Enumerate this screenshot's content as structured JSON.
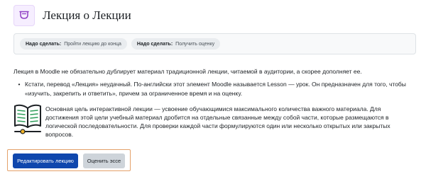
{
  "header": {
    "title": "Лекция о Лекции",
    "icon": "lesson-icon",
    "icon_color": "#8f3fc4"
  },
  "completion": {
    "items": [
      {
        "label": "Надо сделать:",
        "requirement": "Пройти лекцию до конца"
      },
      {
        "label": "Надо сделать:",
        "requirement": "Получить оценку"
      }
    ]
  },
  "content": {
    "intro": "Лекция в Moodle не обязательно дублирует материал традиционной лекции, читаемой в аудитории, а скорее дополняет ее.",
    "bullet": "Кстати, перевод «Лекция» неудачный. По-английски этот элемент Moodle называется Lesson — урок. Он предназначен для того, чтобы «изучить, закрепить и ответить», причем за ограниченное время и на оценку.",
    "paragraph": "Основная цель интерактивной лекции — усвоение обучающимися максимального количества важного материала. Для достижения этой цели учебный материал дробится на отдельные связанные между собой части, которые размещаются в логической последовательности. Для проверки каждой части формулируются один или несколько открытых или закрытых вопросов.",
    "image_icon": "open-book-icon"
  },
  "actions": {
    "edit_label": "Редактировать лекцию",
    "grade_label": "Оценить эссе",
    "primary_color": "#0f47ad"
  }
}
